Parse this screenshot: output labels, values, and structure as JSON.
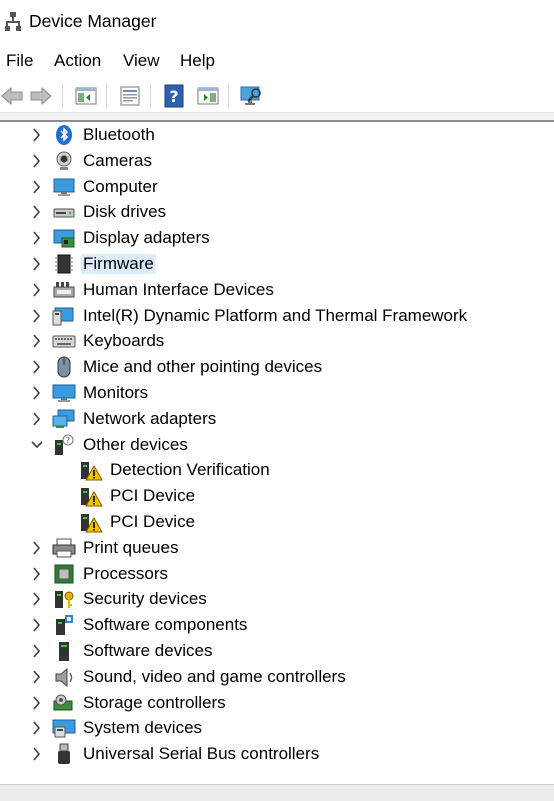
{
  "window": {
    "title": "Device Manager"
  },
  "menu": [
    {
      "label": "File"
    },
    {
      "label": "Action"
    },
    {
      "label": "View"
    },
    {
      "label": "Help"
    }
  ],
  "toolbar": {
    "buttons": [
      "back-arrow-icon",
      "forward-arrow-icon",
      "show-hide-tree-icon",
      "properties-icon",
      "help-icon",
      "action-pane-icon",
      "scan-hardware-icon"
    ]
  },
  "tree": {
    "items": [
      {
        "label": "Bluetooth",
        "icon": "bluetooth-icon",
        "expanded": false
      },
      {
        "label": "Cameras",
        "icon": "camera-icon",
        "expanded": false
      },
      {
        "label": "Computer",
        "icon": "computer-icon",
        "expanded": false
      },
      {
        "label": "Disk drives",
        "icon": "disk-drive-icon",
        "expanded": false
      },
      {
        "label": "Display adapters",
        "icon": "display-adapter-icon",
        "expanded": false
      },
      {
        "label": "Firmware",
        "icon": "firmware-chip-icon",
        "expanded": false,
        "selected": true
      },
      {
        "label": "Human Interface Devices",
        "icon": "hid-icon",
        "expanded": false
      },
      {
        "label": "Intel(R) Dynamic Platform and Thermal Framework",
        "icon": "intel-dptf-icon",
        "expanded": false
      },
      {
        "label": "Keyboards",
        "icon": "keyboard-icon",
        "expanded": false
      },
      {
        "label": "Mice and other pointing devices",
        "icon": "mouse-icon",
        "expanded": false
      },
      {
        "label": "Monitors",
        "icon": "monitor-icon",
        "expanded": false
      },
      {
        "label": "Network adapters",
        "icon": "network-adapter-icon",
        "expanded": false
      },
      {
        "label": "Other devices",
        "icon": "other-devices-icon",
        "expanded": true
      },
      {
        "label": "Detection Verification",
        "icon": "warning-device-icon",
        "child": true
      },
      {
        "label": "PCI Device",
        "icon": "warning-device-icon",
        "child": true
      },
      {
        "label": "PCI Device",
        "icon": "warning-device-icon",
        "child": true
      },
      {
        "label": "Print queues",
        "icon": "printer-icon",
        "expanded": false
      },
      {
        "label": "Processors",
        "icon": "processor-icon",
        "expanded": false
      },
      {
        "label": "Security devices",
        "icon": "security-device-icon",
        "expanded": false
      },
      {
        "label": "Software components",
        "icon": "software-component-icon",
        "expanded": false
      },
      {
        "label": "Software devices",
        "icon": "software-device-icon",
        "expanded": false
      },
      {
        "label": "Sound, video and game controllers",
        "icon": "speaker-icon",
        "expanded": false
      },
      {
        "label": "Storage controllers",
        "icon": "storage-controller-icon",
        "expanded": false
      },
      {
        "label": "System devices",
        "icon": "system-devices-icon",
        "expanded": false
      },
      {
        "label": "Universal Serial Bus controllers",
        "icon": "usb-icon",
        "expanded": false
      }
    ]
  }
}
